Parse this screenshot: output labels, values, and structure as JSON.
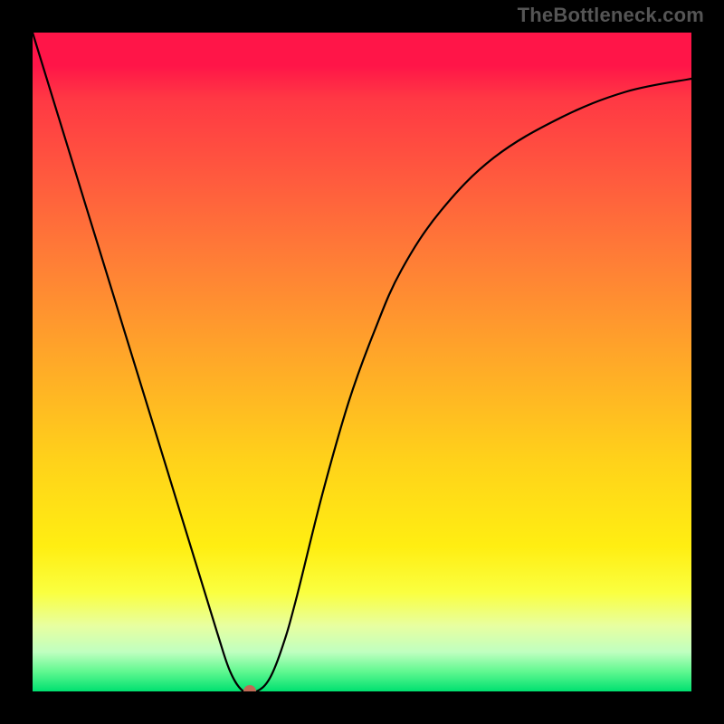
{
  "watermark": "TheBottleneck.com",
  "chart_data": {
    "type": "line",
    "title": "",
    "xlabel": "",
    "ylabel": "",
    "xlim": [
      0,
      1
    ],
    "ylim": [
      0,
      1
    ],
    "series": [
      {
        "name": "curve",
        "x": [
          0.0,
          0.04,
          0.08,
          0.12,
          0.16,
          0.2,
          0.24,
          0.28,
          0.3,
          0.32,
          0.34,
          0.36,
          0.38,
          0.4,
          0.44,
          0.48,
          0.52,
          0.56,
          0.62,
          0.7,
          0.8,
          0.9,
          1.0
        ],
        "values": [
          1.0,
          0.87,
          0.74,
          0.61,
          0.48,
          0.35,
          0.22,
          0.09,
          0.03,
          0.0,
          0.0,
          0.02,
          0.07,
          0.14,
          0.3,
          0.44,
          0.55,
          0.64,
          0.73,
          0.81,
          0.87,
          0.91,
          0.93
        ]
      }
    ],
    "marker": {
      "x": 0.33,
      "y": 0.0,
      "color": "#c16a56"
    },
    "background_gradient": {
      "top": "#ff1548",
      "bottom": "#00e070"
    }
  }
}
